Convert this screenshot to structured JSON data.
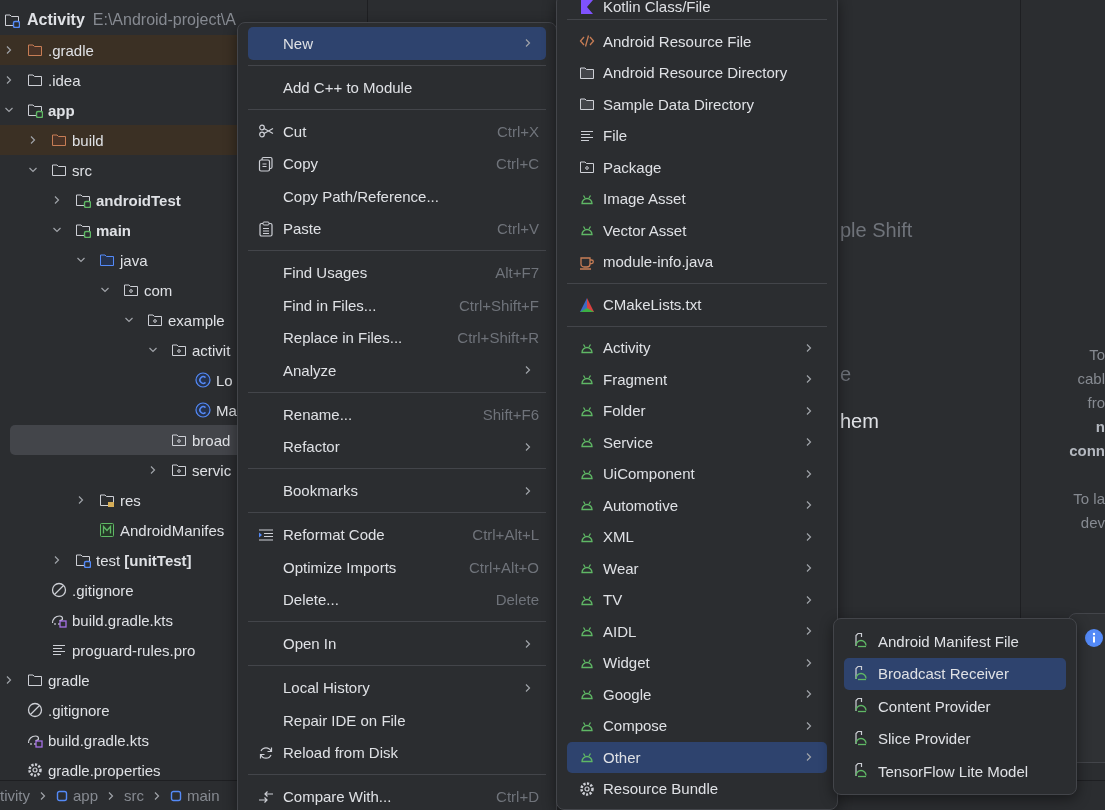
{
  "project_tree": {
    "root": {
      "label": "Activity",
      "path": "E:\\Android-project\\A",
      "kind": "project"
    },
    "items": [
      {
        "label": ".gradle",
        "kind": "excluded-folder",
        "expanded": false,
        "selected": false
      },
      {
        "label": ".idea",
        "kind": "folder",
        "expanded": false,
        "selected": false
      },
      {
        "label": "app",
        "kind": "module",
        "expanded": true,
        "selected": false,
        "children": [
          {
            "label": "build",
            "kind": "excluded-folder",
            "expanded": false,
            "selected": false
          },
          {
            "label": "src",
            "kind": "folder",
            "expanded": true,
            "selected": false,
            "children": [
              {
                "label": "androidTest",
                "kind": "module",
                "expanded": false,
                "selected": false
              },
              {
                "label": "main",
                "kind": "module",
                "expanded": true,
                "selected": false,
                "children": [
                  {
                    "label": "java",
                    "kind": "source-folder",
                    "expanded": true,
                    "selected": false,
                    "children": [
                      {
                        "label": "com",
                        "kind": "package",
                        "expanded": true,
                        "selected": false,
                        "children": [
                          {
                            "label": "example",
                            "kind": "package",
                            "expanded": true,
                            "selected": false,
                            "children": [
                              {
                                "label": "activit",
                                "kind": "package",
                                "expanded": true,
                                "selected": false,
                                "children": [
                                  {
                                    "label": "Lo",
                                    "kind": "class",
                                    "selected": false
                                  },
                                  {
                                    "label": "Ma",
                                    "kind": "class",
                                    "selected": false
                                  }
                                ]
                              },
                              {
                                "label": "broad",
                                "kind": "package",
                                "selected": true
                              },
                              {
                                "label": "servic",
                                "kind": "package",
                                "expanded": false,
                                "selected": false
                              }
                            ]
                          }
                        ]
                      }
                    ]
                  },
                  {
                    "label": "res",
                    "kind": "resource-folder",
                    "expanded": false,
                    "selected": false
                  },
                  {
                    "label": "AndroidManifes",
                    "kind": "manifest",
                    "selected": false
                  }
                ]
              },
              {
                "label": "test **[unitTest]**",
                "kind": "test-module",
                "expanded": false,
                "selected": false
              }
            ]
          },
          {
            "label": ".gitignore",
            "kind": "ignore",
            "selected": false
          },
          {
            "label": "build.gradle.kts",
            "kind": "script",
            "selected": false
          },
          {
            "label": "proguard-rules.pro",
            "kind": "text",
            "selected": false
          }
        ]
      },
      {
        "label": "gradle",
        "kind": "folder",
        "expanded": false,
        "selected": false
      },
      {
        "label": ".gitignore",
        "kind": "ignore",
        "selected": false
      },
      {
        "label": "build.gradle.kts",
        "kind": "script",
        "selected": false
      },
      {
        "label": "gradle.properties",
        "kind": "settings",
        "selected": false
      }
    ]
  },
  "breadcrumb": [
    {
      "label": "tivity",
      "kind": "plain"
    },
    {
      "label": "app",
      "kind": "module"
    },
    {
      "label": "src",
      "kind": "plain"
    },
    {
      "label": "main",
      "kind": "module"
    }
  ],
  "editor_hints": [
    {
      "text": "ple Shift",
      "kind": "muted"
    },
    {
      "text": "e",
      "kind": "muted"
    },
    {
      "text": "hem",
      "kind": "bright"
    }
  ],
  "device_panel": {
    "paragraphs": [
      [
        "To",
        "cabl",
        "fro",
        "**n**",
        "**conn**"
      ],
      [
        "To la",
        "dev"
      ]
    ]
  },
  "notification": {
    "kind": "info"
  },
  "context_menu": {
    "items": [
      {
        "kind": "plain",
        "label": "New",
        "submenu": true,
        "selected": true
      },
      {
        "kind": "separator"
      },
      {
        "kind": "plain",
        "label": "Add C++ to Module",
        "submenu": false,
        "selected": false
      },
      {
        "kind": "separator"
      },
      {
        "kind": "scissors",
        "label": "Cut",
        "shortcut": "Ctrl+X",
        "submenu": false,
        "selected": false
      },
      {
        "kind": "copy",
        "label": "Copy",
        "shortcut": "Ctrl+C",
        "submenu": false,
        "selected": false
      },
      {
        "kind": "plain",
        "label": "Copy Path/Reference...",
        "submenu": false,
        "selected": false
      },
      {
        "kind": "paste",
        "label": "Paste",
        "shortcut": "Ctrl+V",
        "submenu": false,
        "selected": false
      },
      {
        "kind": "separator"
      },
      {
        "kind": "plain",
        "label": "Find Usages",
        "shortcut": "Alt+F7",
        "submenu": false,
        "selected": false
      },
      {
        "kind": "plain",
        "label": "Find in Files...",
        "shortcut": "Ctrl+Shift+F",
        "submenu": false,
        "selected": false
      },
      {
        "kind": "plain",
        "label": "Replace in Files...",
        "shortcut": "Ctrl+Shift+R",
        "submenu": false,
        "selected": false
      },
      {
        "kind": "plain",
        "label": "Analyze",
        "submenu": true,
        "selected": false
      },
      {
        "kind": "separator"
      },
      {
        "kind": "plain",
        "label": "Rename...",
        "shortcut": "Shift+F6",
        "submenu": false,
        "selected": false
      },
      {
        "kind": "plain",
        "label": "Refactor",
        "submenu": true,
        "selected": false
      },
      {
        "kind": "separator"
      },
      {
        "kind": "plain",
        "label": "Bookmarks",
        "submenu": true,
        "selected": false
      },
      {
        "kind": "separator"
      },
      {
        "kind": "reformat",
        "label": "Reformat Code",
        "shortcut": "Ctrl+Alt+L",
        "submenu": false,
        "selected": false
      },
      {
        "kind": "plain",
        "label": "Optimize Imports",
        "shortcut": "Ctrl+Alt+O",
        "submenu": false,
        "selected": false
      },
      {
        "kind": "plain",
        "label": "Delete...",
        "shortcut": "Delete",
        "submenu": false,
        "selected": false
      },
      {
        "kind": "separator"
      },
      {
        "kind": "plain",
        "label": "Open In",
        "submenu": true,
        "selected": false
      },
      {
        "kind": "separator"
      },
      {
        "kind": "plain",
        "label": "Local History",
        "submenu": true,
        "selected": false
      },
      {
        "kind": "plain",
        "label": "Repair IDE on File",
        "submenu": false,
        "selected": false
      },
      {
        "kind": "reload",
        "label": "Reload from Disk",
        "submenu": false,
        "selected": false
      },
      {
        "kind": "separator"
      },
      {
        "kind": "compare",
        "label": "Compare With...",
        "shortcut": "Ctrl+D",
        "submenu": false,
        "selected": false
      }
    ]
  },
  "new_submenu": {
    "items": [
      {
        "kind": "kotlin",
        "label": "Kotlin Class/File",
        "submenu": false,
        "selected": false
      },
      {
        "kind": "separator"
      },
      {
        "kind": "code",
        "label": "Android Resource File",
        "submenu": false,
        "selected": false
      },
      {
        "kind": "folder",
        "label": "Android Resource Directory",
        "submenu": false,
        "selected": false
      },
      {
        "kind": "folder",
        "label": "Sample Data Directory",
        "submenu": false,
        "selected": false
      },
      {
        "kind": "lines",
        "label": "File",
        "submenu": false,
        "selected": false
      },
      {
        "kind": "package",
        "label": "Package",
        "submenu": false,
        "selected": false
      },
      {
        "kind": "robot",
        "label": "Image Asset",
        "submenu": false,
        "selected": false
      },
      {
        "kind": "robot",
        "label": "Vector Asset",
        "submenu": false,
        "selected": false
      },
      {
        "kind": "cup",
        "label": "module-info.java",
        "submenu": false,
        "selected": false
      },
      {
        "kind": "separator"
      },
      {
        "kind": "cmake",
        "label": "CMakeLists.txt",
        "submenu": false,
        "selected": false
      },
      {
        "kind": "separator"
      },
      {
        "kind": "robot",
        "label": "Activity",
        "submenu": true,
        "selected": false
      },
      {
        "kind": "robot",
        "label": "Fragment",
        "submenu": true,
        "selected": false
      },
      {
        "kind": "robot",
        "label": "Folder",
        "submenu": true,
        "selected": false
      },
      {
        "kind": "robot",
        "label": "Service",
        "submenu": true,
        "selected": false
      },
      {
        "kind": "robot",
        "label": "UiComponent",
        "submenu": true,
        "selected": false
      },
      {
        "kind": "robot",
        "label": "Automotive",
        "submenu": true,
        "selected": false
      },
      {
        "kind": "robot",
        "label": "XML",
        "submenu": true,
        "selected": false
      },
      {
        "kind": "robot",
        "label": "Wear",
        "submenu": true,
        "selected": false
      },
      {
        "kind": "robot",
        "label": "TV",
        "submenu": true,
        "selected": false
      },
      {
        "kind": "robot",
        "label": "AIDL",
        "submenu": true,
        "selected": false
      },
      {
        "kind": "robot",
        "label": "Widget",
        "submenu": true,
        "selected": false
      },
      {
        "kind": "robot",
        "label": "Google",
        "submenu": true,
        "selected": false
      },
      {
        "kind": "robot",
        "label": "Compose",
        "submenu": true,
        "selected": false
      },
      {
        "kind": "robot",
        "label": "Other",
        "submenu": true,
        "selected": true
      },
      {
        "kind": "gear",
        "label": "Resource Bundle",
        "submenu": false,
        "selected": false
      }
    ]
  },
  "other_submenu": {
    "items": [
      {
        "kind": "robot-file",
        "label": "Android Manifest File",
        "selected": false
      },
      {
        "kind": "robot-file",
        "label": "Broadcast Receiver",
        "selected": true
      },
      {
        "kind": "robot-file",
        "label": "Content Provider",
        "selected": false
      },
      {
        "kind": "robot-file",
        "label": "Slice Provider",
        "selected": false
      },
      {
        "kind": "robot-file",
        "label": "TensorFlow Lite Model",
        "selected": false
      }
    ]
  }
}
